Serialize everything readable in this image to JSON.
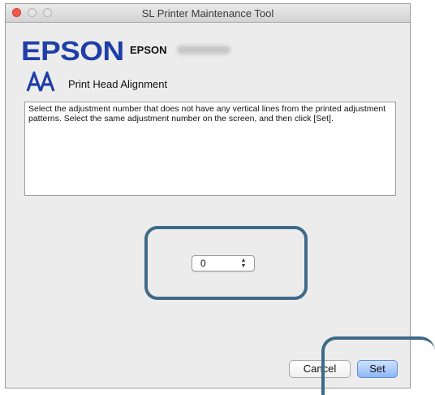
{
  "window": {
    "title": "SL Printer Maintenance Tool"
  },
  "header": {
    "logo": "EPSON",
    "model_prefix": "EPSON",
    "model_suffix_redacted": true
  },
  "section": {
    "icon": "print-head-alignment-icon",
    "title": "Print Head Alignment"
  },
  "instructions": "Select the adjustment number that does not have any vertical lines from the printed adjustment patterns. Select the same adjustment number on the screen, and then click [Set].",
  "adjustment": {
    "selected_value": "0"
  },
  "buttons": {
    "cancel": "Cancel",
    "set": "Set"
  },
  "colors": {
    "brand": "#1f3ea8",
    "highlight": "#3f6a87",
    "default_button": "#8fb7f5"
  }
}
